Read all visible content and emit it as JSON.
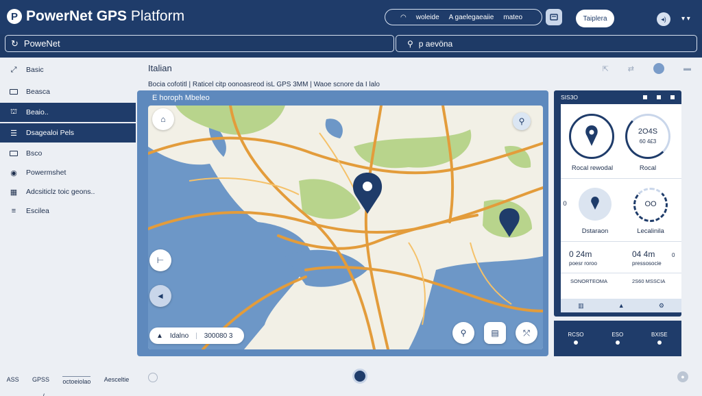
{
  "app": {
    "logo_letter": "P",
    "title_bold": "PowerNet GPS",
    "title_light": " Platform"
  },
  "header": {
    "search_icon": "search-icon",
    "search_word_a": "woleide",
    "search_word_b": "A gaelegaeaiie",
    "search_word_c": "mateo",
    "template_button": "Taiplera",
    "profile_icon_text": "◂)",
    "menu_chevron": "▾ ▾"
  },
  "subheader": {
    "left_label": "PoweNet",
    "right_label": "p aevöna"
  },
  "sidebar": {
    "items": [
      {
        "label": "Basic",
        "icon": "tool-icon",
        "active": false
      },
      {
        "label": "Beasca",
        "icon": "card-icon",
        "active": false
      },
      {
        "label": "Beaio..",
        "icon": "antenna-icon",
        "active": true
      },
      {
        "label": "Dsagealoi Pels",
        "icon": "list-icon",
        "active": true
      },
      {
        "label": "Bsco",
        "icon": "card-icon",
        "active": false
      },
      {
        "label": "Powermshet",
        "icon": "disc-icon",
        "active": false
      },
      {
        "label": "Adcsiticlz toic geons..",
        "icon": "table-icon",
        "active": false
      },
      {
        "label": "Escilea",
        "icon": "lines-icon",
        "active": false
      }
    ],
    "slash": "/",
    "footer": [
      "ASS",
      "GPSS",
      "octoeiolao",
      "Aesceltie"
    ]
  },
  "main": {
    "title": "Italian",
    "breadcrumb": "Bocia cofotitl  |  Raticel citp oonoasreod isL GPS 3MM  |  Waoe scnore da I lalo",
    "map": {
      "caption": "E horoph Mbeleo",
      "coord_label": "Idalno",
      "coord_value": "300080 3"
    },
    "panel": {
      "head_label": "SIS3O",
      "stats": [
        {
          "label": "Rocal rewodal"
        },
        {
          "label": "Rocal",
          "value_top": "2O4S",
          "value_bottom": "60 4£3"
        },
        {
          "label": "Dstaraon"
        },
        {
          "label": "Lecalinila",
          "value_top": "OO"
        }
      ],
      "side_zero": "0",
      "metrics": [
        {
          "value": "0 24m",
          "sub": "poesr roroo"
        },
        {
          "value": "04 4m",
          "sub": "pressosocie"
        }
      ],
      "metric_side": "0",
      "footer_labels": [
        "SONORTEOMA",
        "2S60 MSSCIA"
      ]
    },
    "panel2": [
      "RCSO",
      "ESO",
      "BXISE"
    ]
  },
  "colors": {
    "brand_navy": "#1f3c6a",
    "map_water": "#6d97c7",
    "map_land": "#f2f0e6",
    "road": "#e39c3b",
    "park": "#b8d48c"
  }
}
